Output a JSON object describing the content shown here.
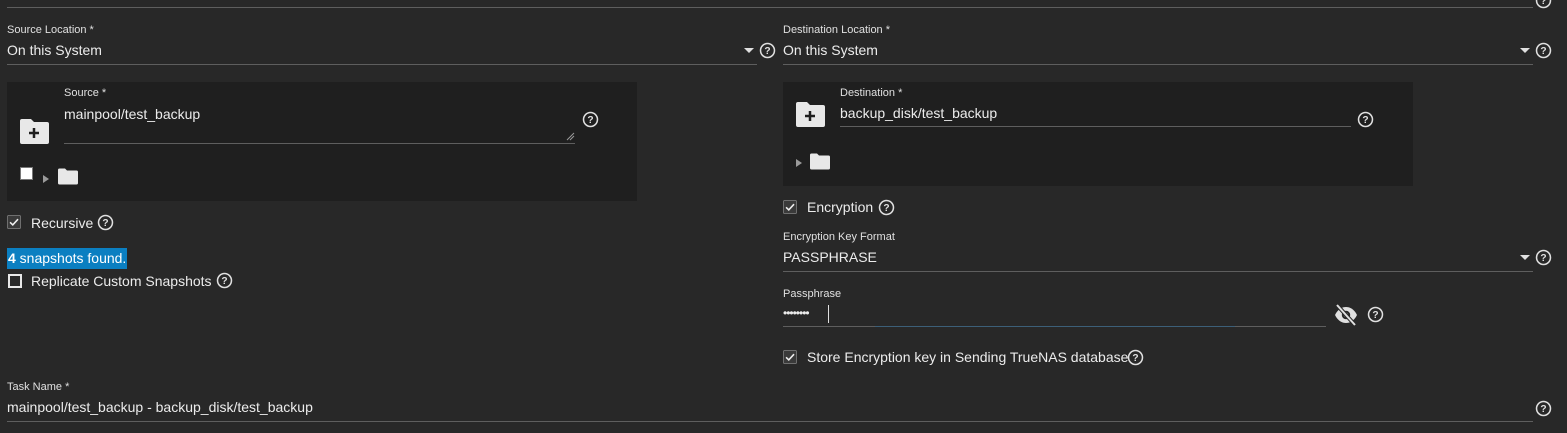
{
  "source_location": {
    "label": "Source Location *",
    "value": "On this System"
  },
  "destination_location": {
    "label": "Destination Location *",
    "value": "On this System"
  },
  "source": {
    "label": "Source *",
    "value": "mainpool/test_backup"
  },
  "destination": {
    "label": "Destination *",
    "value": "backup_disk/test_backup"
  },
  "recursive": {
    "label": "Recursive",
    "checked": true
  },
  "snapshots_found": {
    "count": "4",
    "text": " snapshots found."
  },
  "replicate_custom": {
    "label": "Replicate Custom Snapshots",
    "checked": false
  },
  "encryption": {
    "label": "Encryption",
    "checked": true
  },
  "encryption_key_format": {
    "label": "Encryption Key Format",
    "value": "PASSPHRASE"
  },
  "passphrase": {
    "label": "Passphrase",
    "value": "••••••••"
  },
  "store_key": {
    "label": "Store Encryption key in Sending TrueNAS database",
    "checked": true
  },
  "task_name": {
    "label": "Task Name *",
    "value": "mainpool/test_backup - backup_disk/test_backup"
  },
  "colors": {
    "background": "#282828",
    "panel": "#1f1f1f",
    "highlight": "#0b7fc1",
    "text": "#e4e4e4"
  }
}
